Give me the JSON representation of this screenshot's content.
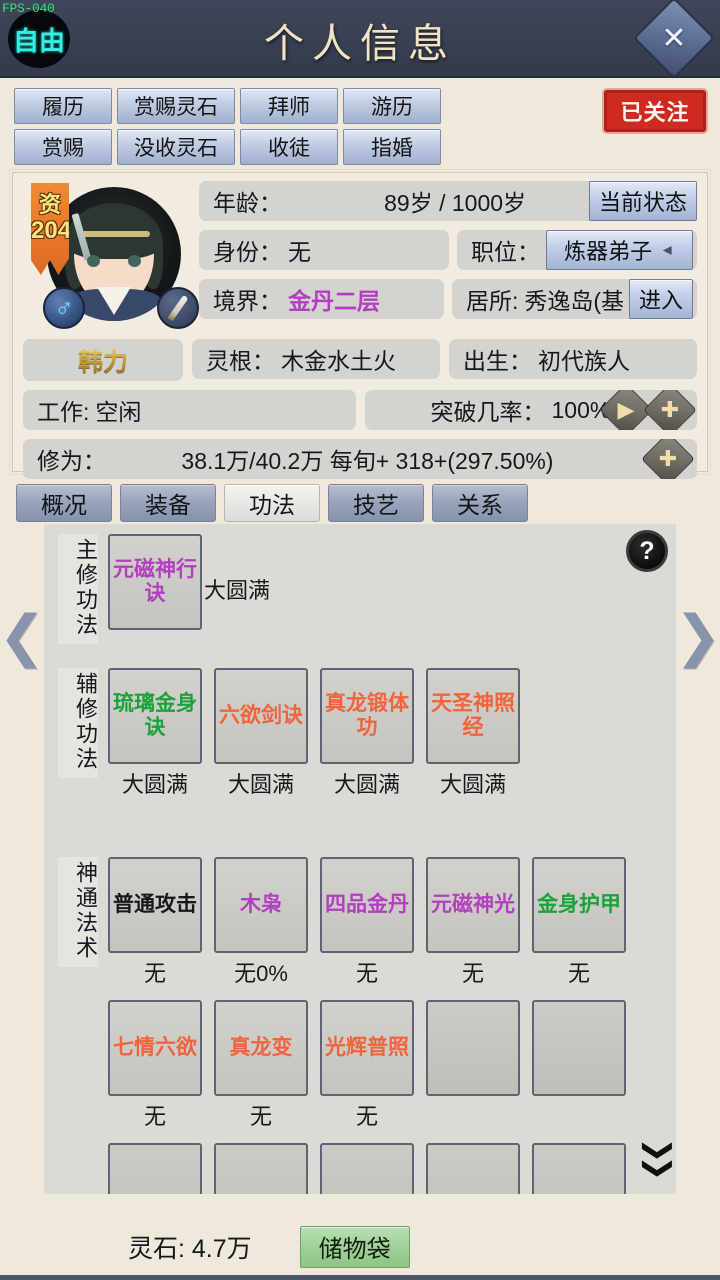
{
  "hud": {
    "fps": "FPS-040",
    "mode_badge": "自由"
  },
  "header": {
    "title": "个人信息",
    "close_icon": "close-x-icon"
  },
  "actions": {
    "row1": [
      "履历",
      "赏赐灵石",
      "拜师",
      "游历"
    ],
    "row2": [
      "赏赐",
      "没收灵石",
      "收徒",
      "指婚"
    ],
    "follow_label": "已关注"
  },
  "character": {
    "resource_badge": {
      "label": "资",
      "value": "204"
    },
    "gender_icon": "male-icon",
    "weapon_icon": "sword-icon",
    "name": "韩力",
    "age_label": "年龄：",
    "age_value": "89岁 / 1000岁",
    "status_button": "当前状态",
    "identity_label": "身份：",
    "identity_value": "无",
    "position_label": "职位：",
    "position_value": "炼器弟子",
    "realm_label": "境界：",
    "realm_value": "金丹二层",
    "realm_color": "#b23fc0",
    "residence_label": "居所:",
    "residence_value": "秀逸岛(基",
    "enter_button": "进入",
    "root_label": "灵根：",
    "root_value": "木金水土火",
    "birth_label": "出生：",
    "birth_value": "初代族人",
    "work_label": "工作:",
    "work_value": "空闲",
    "breakthrough_label": "突破几率：",
    "breakthrough_value": "100%",
    "cultivation_label": "修为：",
    "cultivation_value": "38.1万/40.2万  每旬+  318+(297.50%)"
  },
  "tabs": [
    {
      "label": "概况",
      "active": false
    },
    {
      "label": "装备",
      "active": false
    },
    {
      "label": "功法",
      "active": true
    },
    {
      "label": "技艺",
      "active": false
    },
    {
      "label": "关系",
      "active": false
    }
  ],
  "help_icon": "question-mark-icon",
  "nav": {
    "left_icon": "chevron-left-icon",
    "right_icon": "chevron-right-icon",
    "more_icon": "chevron-double-down-icon"
  },
  "skills": {
    "main": {
      "section_label": "主修功法",
      "card": {
        "name": "元磁神行诀",
        "color_class": "c-purple",
        "level": "大圆满"
      }
    },
    "aux": {
      "section_label": "辅修功法",
      "cards": [
        {
          "name": "琉璃金身诀",
          "color_class": "c-green",
          "level": "大圆满"
        },
        {
          "name": "六欲剑诀",
          "color_class": "c-orange",
          "level": "大圆满"
        },
        {
          "name": "真龙锻体功",
          "color_class": "c-orange",
          "level": "大圆满"
        },
        {
          "name": "天圣神照经",
          "color_class": "c-orange",
          "level": "大圆满"
        }
      ]
    },
    "arts": {
      "section_label": "神通法术",
      "cards": [
        {
          "name": "普通攻击",
          "color_class": "c-black",
          "level": "无"
        },
        {
          "name": "木枭",
          "color_class": "c-purple",
          "level": "无0%"
        },
        {
          "name": "四品金丹",
          "color_class": "c-purple",
          "level": "无"
        },
        {
          "name": "元磁神光",
          "color_class": "c-purple",
          "level": "无"
        },
        {
          "name": "金身护甲",
          "color_class": "c-green",
          "level": "无"
        },
        {
          "name": "七情六欲",
          "color_class": "c-orange",
          "level": "无"
        },
        {
          "name": "真龙变",
          "color_class": "c-orange",
          "level": "无"
        },
        {
          "name": "光辉普照",
          "color_class": "c-orange",
          "level": "无"
        },
        {
          "name": "",
          "color_class": "c-black",
          "level": ""
        },
        {
          "name": "",
          "color_class": "c-black",
          "level": ""
        },
        {
          "name": "",
          "color_class": "c-black",
          "level": ""
        },
        {
          "name": "",
          "color_class": "c-black",
          "level": ""
        },
        {
          "name": "",
          "color_class": "c-black",
          "level": ""
        },
        {
          "name": "",
          "color_class": "c-black",
          "level": ""
        },
        {
          "name": "",
          "color_class": "c-black",
          "level": ""
        }
      ]
    }
  },
  "footer": {
    "stone_text": "灵石: 4.7万",
    "bag_label": "储物袋"
  }
}
